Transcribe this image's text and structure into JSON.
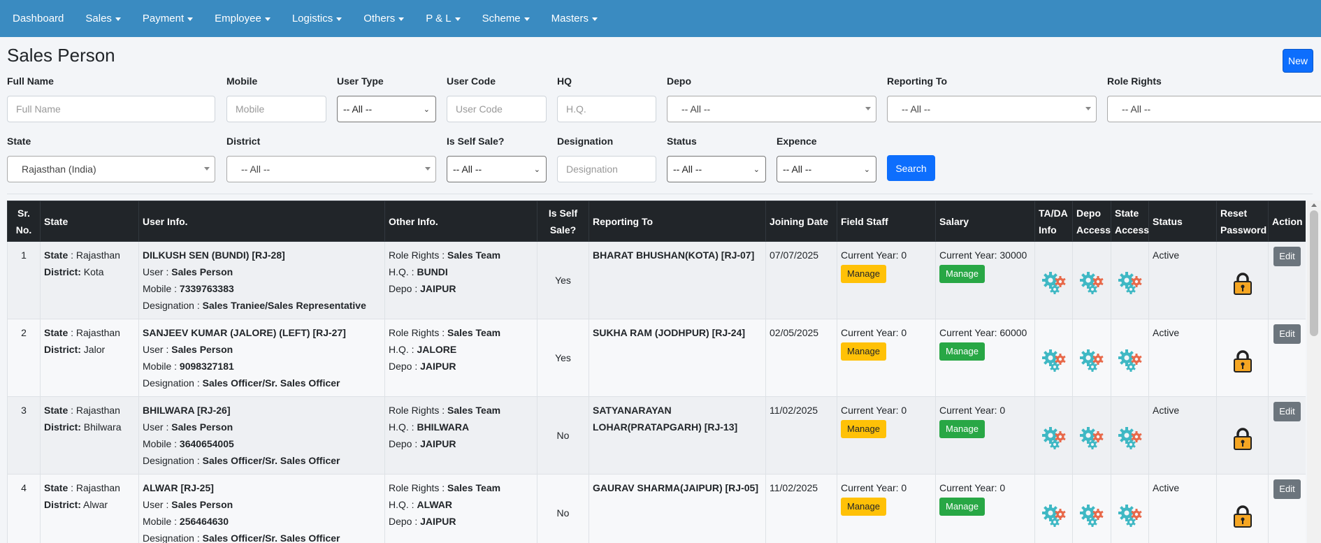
{
  "nav": {
    "items": [
      {
        "label": "Dashboard",
        "dropdown": false
      },
      {
        "label": "Sales",
        "dropdown": true
      },
      {
        "label": "Payment",
        "dropdown": true
      },
      {
        "label": "Employee",
        "dropdown": true
      },
      {
        "label": "Logistics",
        "dropdown": true
      },
      {
        "label": "Others",
        "dropdown": true
      },
      {
        "label": "P & L",
        "dropdown": true
      },
      {
        "label": "Scheme",
        "dropdown": true
      },
      {
        "label": "Masters",
        "dropdown": true
      }
    ]
  },
  "page": {
    "title": "Sales Person",
    "new_label": "New"
  },
  "filters": {
    "full_name": {
      "label": "Full Name",
      "placeholder": "Full Name"
    },
    "mobile": {
      "label": "Mobile",
      "placeholder": "Mobile"
    },
    "user_type": {
      "label": "User Type",
      "value": "-- All --"
    },
    "user_code": {
      "label": "User Code",
      "placeholder": "User Code"
    },
    "hq": {
      "label": "HQ",
      "placeholder": "H.Q."
    },
    "depo": {
      "label": "Depo",
      "value": "-- All --"
    },
    "reporting_to": {
      "label": "Reporting To",
      "value": "-- All --"
    },
    "role_rights": {
      "label": "Role Rights",
      "value": "-- All --"
    },
    "state": {
      "label": "State",
      "value": "Rajasthan (India)"
    },
    "district": {
      "label": "District",
      "value": "-- All --"
    },
    "is_self_sale": {
      "label": "Is Self Sale?",
      "value": "-- All --"
    },
    "designation": {
      "label": "Designation",
      "placeholder": "Designation"
    },
    "status": {
      "label": "Status",
      "value": "-- All --"
    },
    "expence": {
      "label": "Expence",
      "value": "-- All --"
    },
    "search_label": "Search"
  },
  "table": {
    "headers": {
      "sr": "Sr. No.",
      "state": "State",
      "user_info": "User Info.",
      "other_info": "Other Info.",
      "self_sale": "Is Self Sale?",
      "reporting_to": "Reporting To",
      "joining": "Joining Date",
      "field_staff": "Field Staff",
      "salary": "Salary",
      "tada": "TA/DA Info",
      "depo_access": "Depo Access",
      "state_access": "State Access",
      "status": "Status",
      "reset_password": "Reset Password",
      "action": "Action"
    },
    "labels": {
      "state": "State",
      "district": "District:",
      "user": "User :",
      "mobile": "Mobile :",
      "designation": "Designation :",
      "role_rights": "Role Rights :",
      "hq": "H.Q. :",
      "depo": "Depo :",
      "current_year": "Current Year:",
      "manage": "Manage",
      "edit": "Edit"
    },
    "rows": [
      {
        "sr": "1",
        "state": "Rajasthan",
        "district": "Kota",
        "name": "DILKUSH SEN (BUNDI) [RJ-28]",
        "user": "Sales Person",
        "mobile": "7339763383",
        "designation": "Sales Traniee/Sales Representative",
        "role_rights": "Sales Team",
        "hq": "BUNDI",
        "depo": "JAIPUR",
        "self_sale": "Yes",
        "reporting_to": "BHARAT BHUSHAN(KOTA) [RJ-07]",
        "joining": "07/07/2025",
        "field_staff_cy": "0",
        "salary_cy": "30000",
        "status": "Active"
      },
      {
        "sr": "2",
        "state": "Rajasthan",
        "district": "Jalor",
        "name": "SANJEEV KUMAR (JALORE) (LEFT) [RJ-27]",
        "user": "Sales Person",
        "mobile": "9098327181",
        "designation": "Sales Officer/Sr. Sales Officer",
        "role_rights": "Sales Team",
        "hq": "JALORE",
        "depo": "JAIPUR",
        "self_sale": "Yes",
        "reporting_to": "SUKHA RAM (JODHPUR) [RJ-24]",
        "joining": "02/05/2025",
        "field_staff_cy": "0",
        "salary_cy": "60000",
        "status": "Active"
      },
      {
        "sr": "3",
        "state": "Rajasthan",
        "district": "Bhilwara",
        "name": "BHILWARA [RJ-26]",
        "user": "Sales Person",
        "mobile": "3640654005",
        "designation": "Sales Officer/Sr. Sales Officer",
        "role_rights": "Sales Team",
        "hq": "BHILWARA",
        "depo": "JAIPUR",
        "self_sale": "No",
        "reporting_to": "SATYANARAYAN LOHAR(PRATAPGARH) [RJ-13]",
        "joining": "11/02/2025",
        "field_staff_cy": "0",
        "salary_cy": "0",
        "status": "Active"
      },
      {
        "sr": "4",
        "state": "Rajasthan",
        "district": "Alwar",
        "name": "ALWAR [RJ-25]",
        "user": "Sales Person",
        "mobile": "256464630",
        "designation": "Sales Officer/Sr. Sales Officer",
        "role_rights": "Sales Team",
        "hq": "ALWAR",
        "depo": "JAIPUR",
        "self_sale": "No",
        "reporting_to": "GAURAV SHARMA(JAIPUR) [RJ-05]",
        "joining": "11/02/2025",
        "field_staff_cy": "0",
        "salary_cy": "0",
        "status": "Active"
      }
    ]
  },
  "icons": {
    "tada": "gears-icon",
    "depo_access": "gears-icon",
    "state_access": "gears-icon",
    "reset_password": "lock-icon"
  },
  "colors": {
    "navbar": "#3a8bc1",
    "primary": "#0d6efd",
    "header": "#212529",
    "warning": "#ffc107",
    "success": "#28a745",
    "secondary": "#6c757d"
  }
}
